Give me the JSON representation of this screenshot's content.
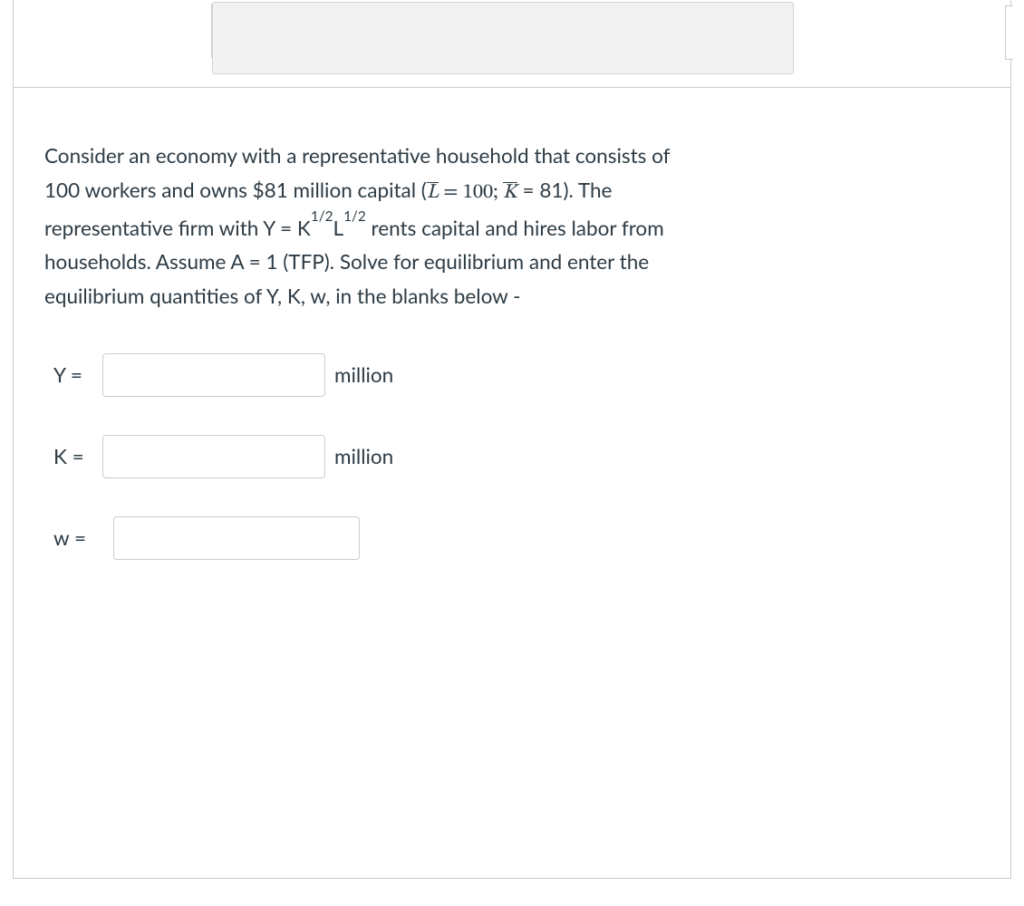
{
  "prompt": {
    "p1a": "Consider an economy with a representative household that consists of",
    "p2a": "100 workers and owns $81 million capital (",
    "Lbar": "L",
    "eq1": " = 100; ",
    "Kbar": "K",
    "eq2": " = 81). The",
    "p3a": "representative firm with Y = K",
    "exp1": "1/2",
    "p3b": "L",
    "exp2": "1/2",
    "p3c": " rents capital and hires labor from",
    "p4": "households.  Assume A = 1 (TFP). Solve for equilibrium and enter the",
    "p5": "equilibrium quantities of Y, K, w, in the blanks below -"
  },
  "blanks": {
    "y": {
      "label": "Y =",
      "unit": "million"
    },
    "k": {
      "label": "K =",
      "unit": "million"
    },
    "w": {
      "label": "w ="
    }
  }
}
